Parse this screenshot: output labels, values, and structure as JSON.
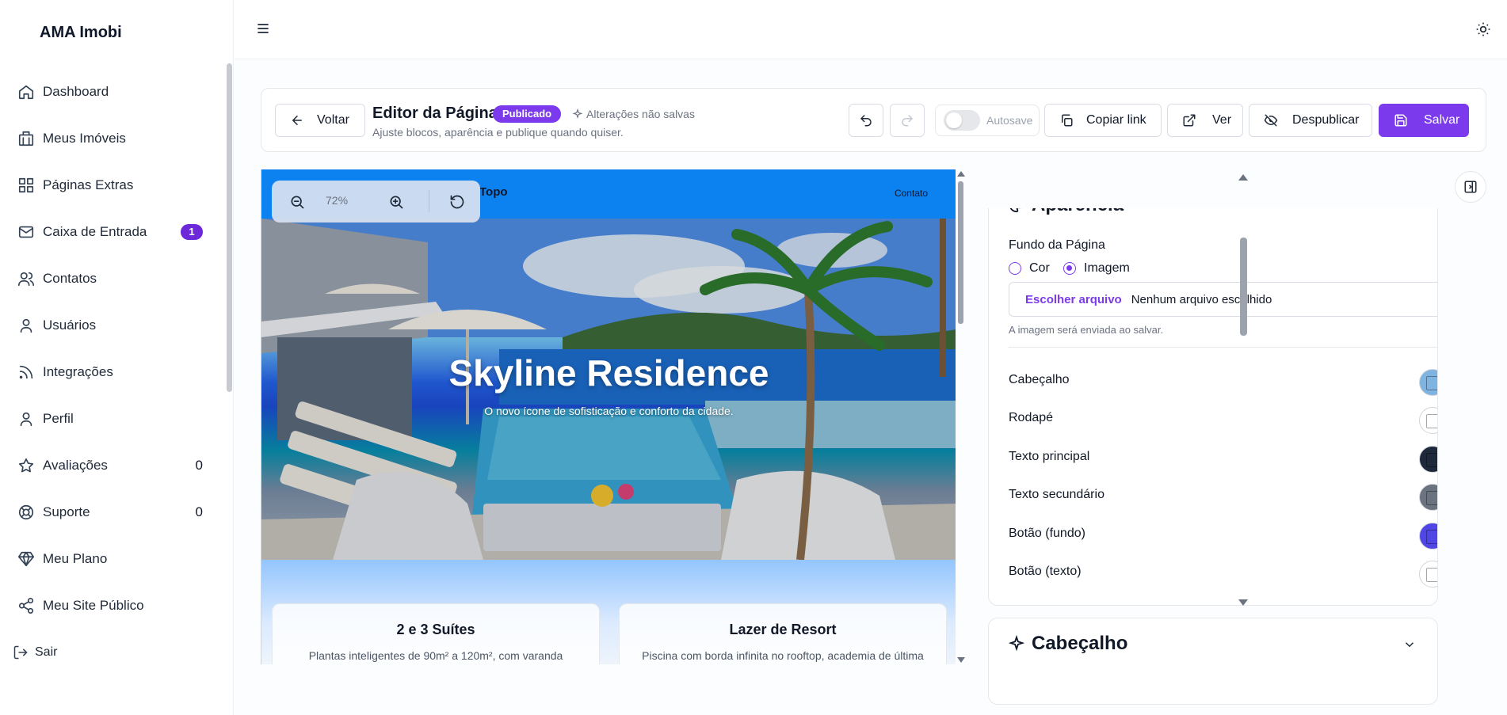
{
  "sidebar": {
    "brand": "AMA Imobi",
    "items": [
      {
        "label": "Dashboard",
        "icon": "home-icon"
      },
      {
        "label": "Meus Imóveis",
        "icon": "building-icon"
      },
      {
        "label": "Páginas Extras",
        "icon": "grid-icon"
      },
      {
        "label": "Caixa de Entrada",
        "icon": "mail-icon",
        "badge": "1"
      },
      {
        "label": "Contatos",
        "icon": "users-icon"
      },
      {
        "label": "Usuários",
        "icon": "user-icon"
      },
      {
        "label": "Integrações",
        "icon": "rss-icon"
      },
      {
        "label": "Perfil",
        "icon": "user-icon"
      },
      {
        "label": "Avaliações",
        "icon": "star-icon",
        "count": "0"
      },
      {
        "label": "Suporte",
        "icon": "lifebuoy-icon",
        "count": "0"
      },
      {
        "label": "Meu Plano",
        "icon": "diamond-icon"
      },
      {
        "label": "Meu Site Público",
        "icon": "share-icon"
      }
    ],
    "logout": "Sair"
  },
  "editor": {
    "back": "Voltar",
    "title": "Editor da Página",
    "status_badge": "Publicado",
    "unsaved": "Alterações não salvas",
    "subtitle": "Ajuste blocos, aparência e publique quando quiser.",
    "autosave": "Autosave",
    "copy_link": "Copiar link",
    "view": "Ver",
    "unpublish": "Despublicar",
    "save": "Salvar"
  },
  "preview": {
    "zoom": "72%",
    "nav_top": "Topo",
    "nav_contact": "Contato",
    "hero_title": "Skyline Residence",
    "hero_subtitle": "O novo ícone de sofisticação e conforto da cidade.",
    "features": [
      {
        "title": "2 e 3 Suítes",
        "desc": "Plantas inteligentes de 90m² a 120m², com varanda"
      },
      {
        "title": "Lazer de Resort",
        "desc": "Piscina com borda infinita no rooftop, academia de última"
      }
    ]
  },
  "appearance": {
    "title": "Aparência",
    "background_label": "Fundo da Página",
    "option_color": "Cor",
    "option_image": "Imagem",
    "selected": "Imagem",
    "file_button": "Escolher arquivo",
    "file_status": "Nenhum arquivo escolhido",
    "file_hint": "A imagem será enviada ao salvar.",
    "colors": [
      {
        "label": "Cabeçalho",
        "color": "#7fb3e0"
      },
      {
        "label": "Rodapé",
        "color": "#ffffff"
      },
      {
        "label": "Texto principal",
        "color": "#1e293b"
      },
      {
        "label": "Texto secundário",
        "color": "#6b7280"
      },
      {
        "label": "Botão (fundo)",
        "color": "#4f46e5"
      },
      {
        "label": "Botão (texto)",
        "color": "#ffffff"
      }
    ]
  },
  "header_section": {
    "title": "Cabeçalho"
  },
  "colors": {
    "accent": "#7c3aed",
    "preview_header": "#0c82f1"
  }
}
